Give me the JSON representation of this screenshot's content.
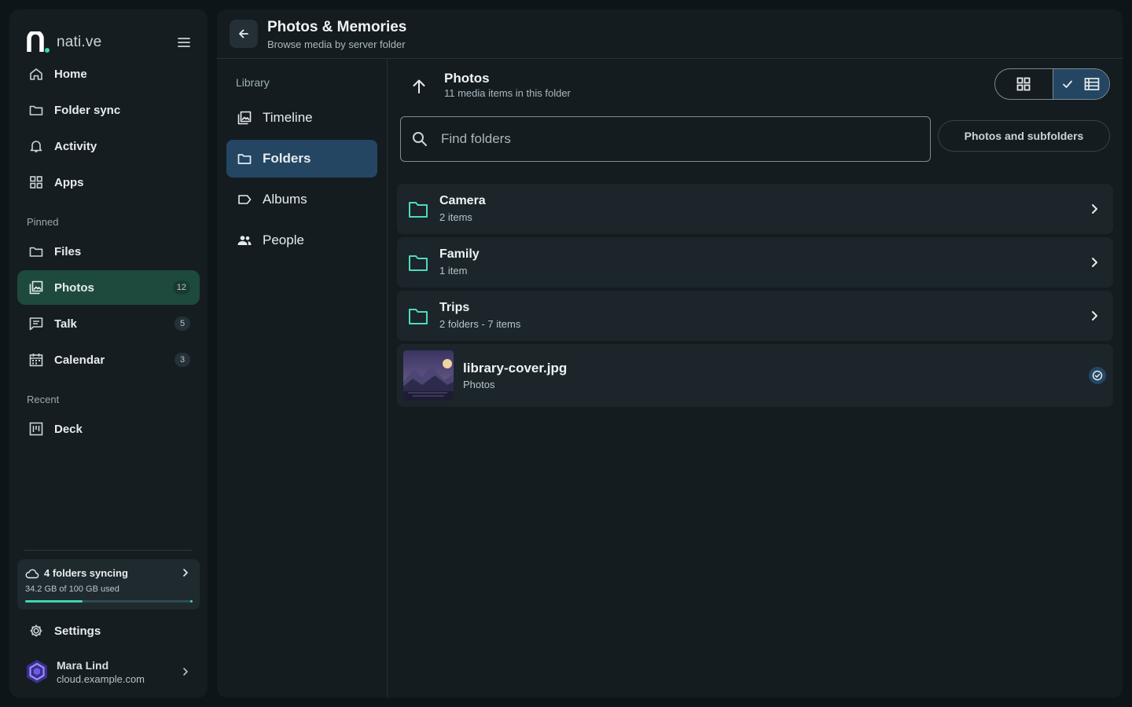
{
  "app": {
    "brand": "nati.ve"
  },
  "sidebar": {
    "nav": [
      {
        "label": "Home",
        "icon": "home-icon"
      },
      {
        "label": "Folder sync",
        "icon": "folder-icon"
      },
      {
        "label": "Activity",
        "icon": "bell-icon"
      },
      {
        "label": "Apps",
        "icon": "apps-grid-icon"
      }
    ],
    "pinned_label": "Pinned",
    "pinned": [
      {
        "label": "Files",
        "icon": "folder-icon"
      },
      {
        "label": "Photos",
        "icon": "photos-icon",
        "badge": "12",
        "active": true
      },
      {
        "label": "Talk",
        "icon": "chat-icon",
        "badge": "5"
      },
      {
        "label": "Calendar",
        "icon": "calendar-icon",
        "badge": "3"
      }
    ],
    "recent_label": "Recent",
    "recent": [
      {
        "label": "Deck",
        "icon": "deck-icon"
      }
    ],
    "sync": {
      "title": "4 folders syncing",
      "usage": "34.2 GB of 100 GB used",
      "used_fraction": 0.342
    },
    "settings_label": "Settings",
    "user": {
      "name": "Mara Lind",
      "host": "cloud.example.com"
    }
  },
  "header": {
    "title": "Photos & Memories",
    "subtitle": "Browse media by server folder"
  },
  "library": {
    "label": "Library",
    "items": [
      {
        "label": "Timeline",
        "icon": "timeline-icon"
      },
      {
        "label": "Folders",
        "icon": "folder-icon",
        "active": true
      },
      {
        "label": "Albums",
        "icon": "tag-icon"
      },
      {
        "label": "People",
        "icon": "people-icon"
      }
    ]
  },
  "folder": {
    "title": "Photos",
    "subtitle": "11 media items in this folder"
  },
  "search": {
    "placeholder": "Find folders",
    "value": ""
  },
  "filter": {
    "label": "Photos and subfolders"
  },
  "view_mode": {
    "selected": "list"
  },
  "rows": [
    {
      "name": "Camera",
      "meta": "2 items"
    },
    {
      "name": "Family",
      "meta": "1 item"
    },
    {
      "name": "Trips",
      "meta": "2 folders - 7 items"
    }
  ],
  "file": {
    "name": "library-cover.jpg",
    "location": "Photos",
    "selected": true
  },
  "colors": {
    "accent_green": "#3ed6b0",
    "active_nav": "#1d4a3d",
    "active_blue": "#244663",
    "folder_icon": "#4fd9c0"
  }
}
